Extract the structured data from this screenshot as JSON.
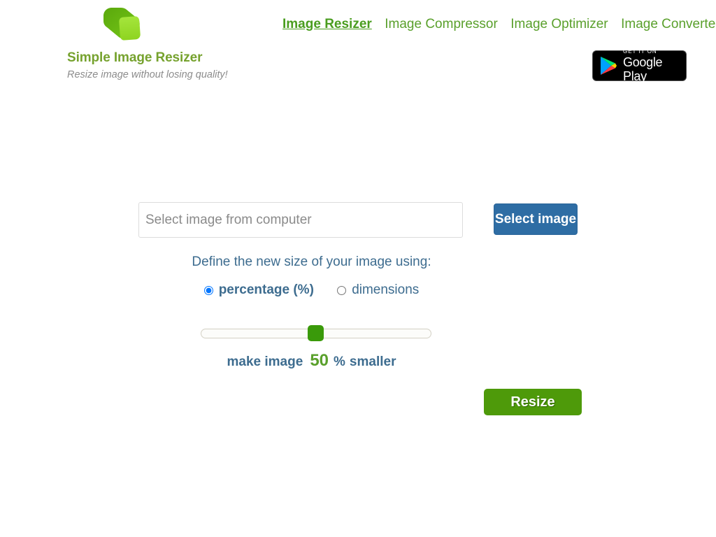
{
  "brand": {
    "logo_icon": "green-arrow-cursor-logo",
    "title": "Simple Image Resizer",
    "tagline": "Resize image without losing quality!",
    "title_color": "#76a22e"
  },
  "nav": {
    "items": [
      {
        "label": "Image Resizer",
        "active": true
      },
      {
        "label": "Image Compressor",
        "active": false
      },
      {
        "label": "Image Optimizer",
        "active": false
      },
      {
        "label": "Image Converter",
        "active": false
      }
    ],
    "active_color": "#4a9d1f",
    "link_color": "#5aa02c"
  },
  "google_play": {
    "small_text": "GET IT ON",
    "big_text": "Google Play",
    "icon": "google-play-triangle-icon"
  },
  "form": {
    "file_placeholder": "Select image from computer",
    "file_value": "",
    "select_button_label": "Select image",
    "select_button_color": "#2e6da4",
    "define_label": "Define the new size of your image using:",
    "options": [
      {
        "label": "percentage (%)",
        "selected": true
      },
      {
        "label": "dimensions",
        "selected": false
      }
    ],
    "slider": {
      "value": 50,
      "min": 0,
      "max": 100,
      "handle_color": "#3a9a0a"
    },
    "percent_prefix": "make image",
    "percent_value": "50",
    "percent_unit": "%",
    "percent_suffix": "smaller",
    "percent_value_color": "#5aa02c",
    "resize_button_label": "Resize",
    "resize_button_color": "#4e9a0a",
    "text_color": "#3d6c8f"
  }
}
